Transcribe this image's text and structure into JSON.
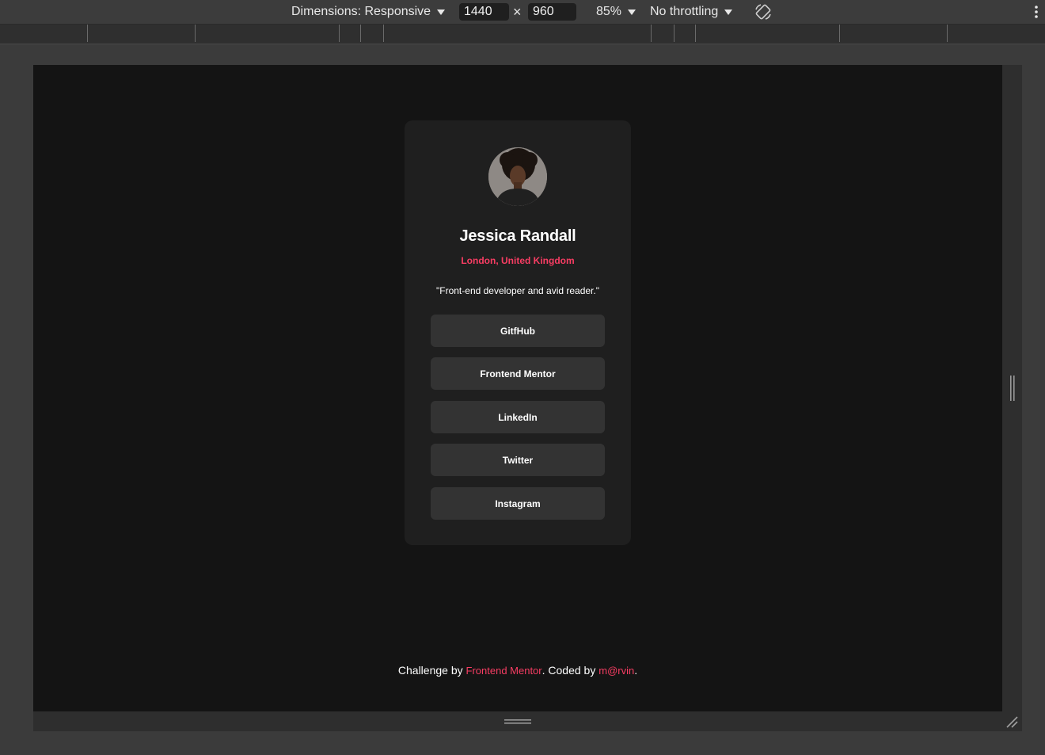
{
  "devtools": {
    "dimensions_label": "Dimensions: Responsive",
    "width_value": "1440",
    "times": "×",
    "height_value": "960",
    "zoom": "85%",
    "throttling": "No throttling"
  },
  "profile": {
    "name": "Jessica Randall",
    "location": "London, United Kingdom",
    "bio": "\"Front-end developer and avid reader.\"",
    "accent_color": "#f83d63"
  },
  "links": [
    {
      "label": "GitfHub"
    },
    {
      "label": "Frontend Mentor"
    },
    {
      "label": "LinkedIn"
    },
    {
      "label": "Twitter"
    },
    {
      "label": "Instagram"
    }
  ],
  "attribution": {
    "prefix": "Challenge by ",
    "challenge_link": "Frontend Mentor",
    "middle": ". Coded by ",
    "author_link": "m@rvin",
    "suffix": "."
  }
}
